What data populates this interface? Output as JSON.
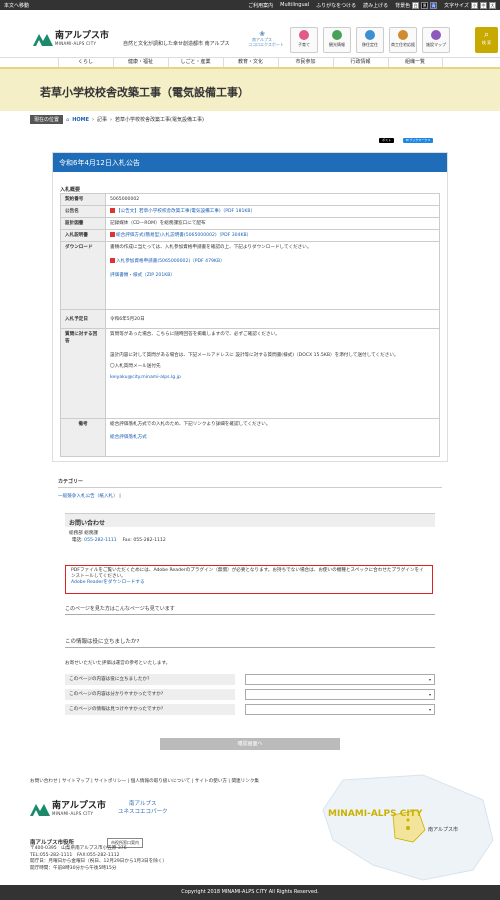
{
  "topbar": {
    "skip": "本文へ移動",
    "links": [
      "ご利用案内",
      "Multilingual",
      "ふりがなをつける",
      "読み上げる"
    ],
    "bg_label": "背景色",
    "bg_options": [
      "白",
      "黒",
      "青"
    ],
    "size_label": "文字サイズ",
    "size_options": [
      "小",
      "中",
      "大"
    ]
  },
  "header": {
    "logo_name": "南アルプス市",
    "logo_en": "MINAMI-ALPS CITY",
    "tagline": "自然と文化が調和した幸せ創造都市 南アルプス",
    "kokoro": "南アルプス\nココロエクスポート",
    "icons": [
      {
        "label": "子育て",
        "color": "#e05a8a"
      },
      {
        "label": "観光情報",
        "color": "#4aa05a"
      },
      {
        "label": "移住定住",
        "color": "#3c8fd0"
      },
      {
        "label": "商工住宅応援",
        "color": "#d08a30"
      },
      {
        "label": "施設マップ",
        "color": "#8c5ab8"
      }
    ],
    "search_label": "検 索"
  },
  "nav": [
    "くらし",
    "健康・福祉",
    "しごと・産業",
    "教育・文化",
    "市民参加",
    "行政情報",
    "組織一覧"
  ],
  "page_title": "若草小学校校舎改築工事（電気設備工事）",
  "breadcrumb": {
    "label": "現在の位置",
    "home": "HOME",
    "items": [
      "記事",
      "若草小学校校舎改築工事(電気設備工事)"
    ]
  },
  "social": [
    "ポスト",
    "B!ブックマーク 0"
  ],
  "notice_title": "令和6年4月12日入札公告",
  "section_label": "入札概要",
  "rows": [
    {
      "h": "契約番号",
      "lines": [
        "5065000002"
      ]
    },
    {
      "h": "公告名",
      "lines": [
        "【公告文】若草小学校校舎改築工事(電気設備工事)（PDF 181KB）"
      ],
      "links": true
    },
    {
      "h": "設計図書",
      "lines": [
        "記録媒体（CD－ROM）を総務課窓口にて配布"
      ]
    },
    {
      "h": "入札説明書",
      "lines": [
        "総合評価方式(簡易型)入札説明書(5065000002)（PDF 304KB）"
      ],
      "links": true
    },
    {
      "h": "ダウンロード",
      "lines": [
        "書類の作成に当たっては、入札参加資格申請書を確認の上、下記よりダウンロードしてください。",
        "入札参加資格申請書(5065000002)（PDF 479KB）",
        "評価書類・様式（ZIP 201KB）"
      ]
    },
    {
      "h": "入札予定日",
      "lines": [
        "令和6年5月20日"
      ]
    },
    {
      "h": "質問に対する回答",
      "lines": [
        "質問等があった場合、こちらに随時回答を掲載しますので、必ずご確認ください。",
        "設計内容に対して質問がある場合は、下記メールアドレスに 設計等に対する質問書(様式)（DOCX 15.5KB）を添付して送付してください。",
        "〇入札質問メール送付先",
        "keiyaku@city.minami-alps.lg.jp"
      ]
    },
    {
      "h": "備考",
      "lines": [
        "総合評価落札方式での入札のため、下記リンクより詳細を確認してください。",
        "総合評価落札方式"
      ]
    }
  ],
  "category": {
    "title": "カテゴリー",
    "link": "一般競争入札公告（紙入札）"
  },
  "contact": {
    "title": "お問い合わせ",
    "dept": "総務部 総務課",
    "tel_label": "電話:",
    "tel": "055-282-1111",
    "fax_label": "Fax:",
    "fax": "055-282-1112"
  },
  "adobe": {
    "text": "PDFファイルをご覧いただくためには、Adobe Readerのプラグイン（無償）が必要となります。お持ちでない場合は、お使いの機種とスペックに合わせたプラグインをインストールしてください。",
    "link": "Adobe Readerをダウンロードする"
  },
  "survey": {
    "also": "このページを見た方はこんなページも見ています",
    "title": "この情報は役に立ちましたか?",
    "intro": "お寄せいただいた評価は運営の参考といたします。",
    "questions": [
      "このページの内容は役に立ちましたか?",
      "このページの内容は分かりやすかったですか?",
      "このページの情報は見つけやすかったですか?"
    ],
    "confirm": "確認画面へ"
  },
  "footer": {
    "links": [
      "お問い合わせ",
      "サイトマップ",
      "サイトポリシー",
      "個人情報の取り扱いについて",
      "サイトの使い方",
      "関連リンク集"
    ],
    "logo2": "南アルプス\nユネスコエコパーク",
    "office": "南アルプス市役所",
    "map_btn": "市役所窓口案内",
    "address": [
      "〒400-0395　山梨県南アルプス市小笠原 376",
      "TEL:055-282-1111　FAX:055-282-1112",
      "開庁日：月曜日から金曜日（祝日、12月29日から1月3日を除く）",
      "開庁時間：午前8時30分から午後5時15分"
    ],
    "map_title": "MINAMI-ALPS CITY",
    "map_label": "南アルプス市"
  },
  "copyright": "Copyright 2018 MINAMI-ALPS CITY All Rights Reserved."
}
